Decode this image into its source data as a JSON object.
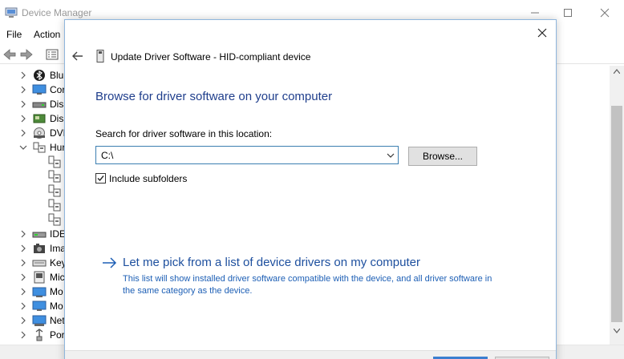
{
  "device_manager": {
    "title": "Device Manager",
    "menu": [
      "File",
      "Action"
    ],
    "tree": [
      {
        "label": "Blu",
        "icon": "bluetooth-icon",
        "state": "collapsed"
      },
      {
        "label": "Cor",
        "icon": "computer-icon",
        "state": "collapsed"
      },
      {
        "label": "Disk",
        "icon": "disk-drive-icon",
        "state": "collapsed"
      },
      {
        "label": "Disp",
        "icon": "display-adapter-icon",
        "state": "collapsed"
      },
      {
        "label": "DVD",
        "icon": "dvd-drive-icon",
        "state": "collapsed"
      },
      {
        "label": "Hur",
        "icon": "hid-icon",
        "state": "expanded"
      },
      {
        "label": "IDE",
        "icon": "ide-controller-icon",
        "state": "collapsed"
      },
      {
        "label": "Ima",
        "icon": "imaging-device-icon",
        "state": "collapsed"
      },
      {
        "label": "Key",
        "icon": "keyboard-icon",
        "state": "collapsed"
      },
      {
        "label": "Mic",
        "icon": "mice-icon",
        "state": "collapsed"
      },
      {
        "label": "Mo",
        "icon": "modem-icon",
        "state": "collapsed"
      },
      {
        "label": "Mo",
        "icon": "monitor-icon",
        "state": "collapsed"
      },
      {
        "label": "Net",
        "icon": "network-adapter-icon",
        "state": "collapsed"
      },
      {
        "label": "Por",
        "icon": "port-icon",
        "state": "collapsed"
      }
    ],
    "hid_children_count": 5
  },
  "dialog": {
    "title": "Update Driver Software - HID-compliant device",
    "heading": "Browse for driver software on your computer",
    "search_label": "Search for driver software in this location:",
    "path_value": "C:\\",
    "browse_label": "Browse...",
    "include_subfolders_label": "Include subfolders",
    "include_subfolders_checked": true,
    "pick_link": "Let me pick from a list of device drivers on my computer",
    "pick_description": "This list will show installed driver software compatible with the device, and all driver software in the same category as the device."
  },
  "colors": {
    "heading": "#1f3e8c",
    "link": "#1d4f9e",
    "description": "#1d5fb5",
    "dialog_border": "#8fb6dd",
    "combo_border": "#3c7fb1"
  }
}
